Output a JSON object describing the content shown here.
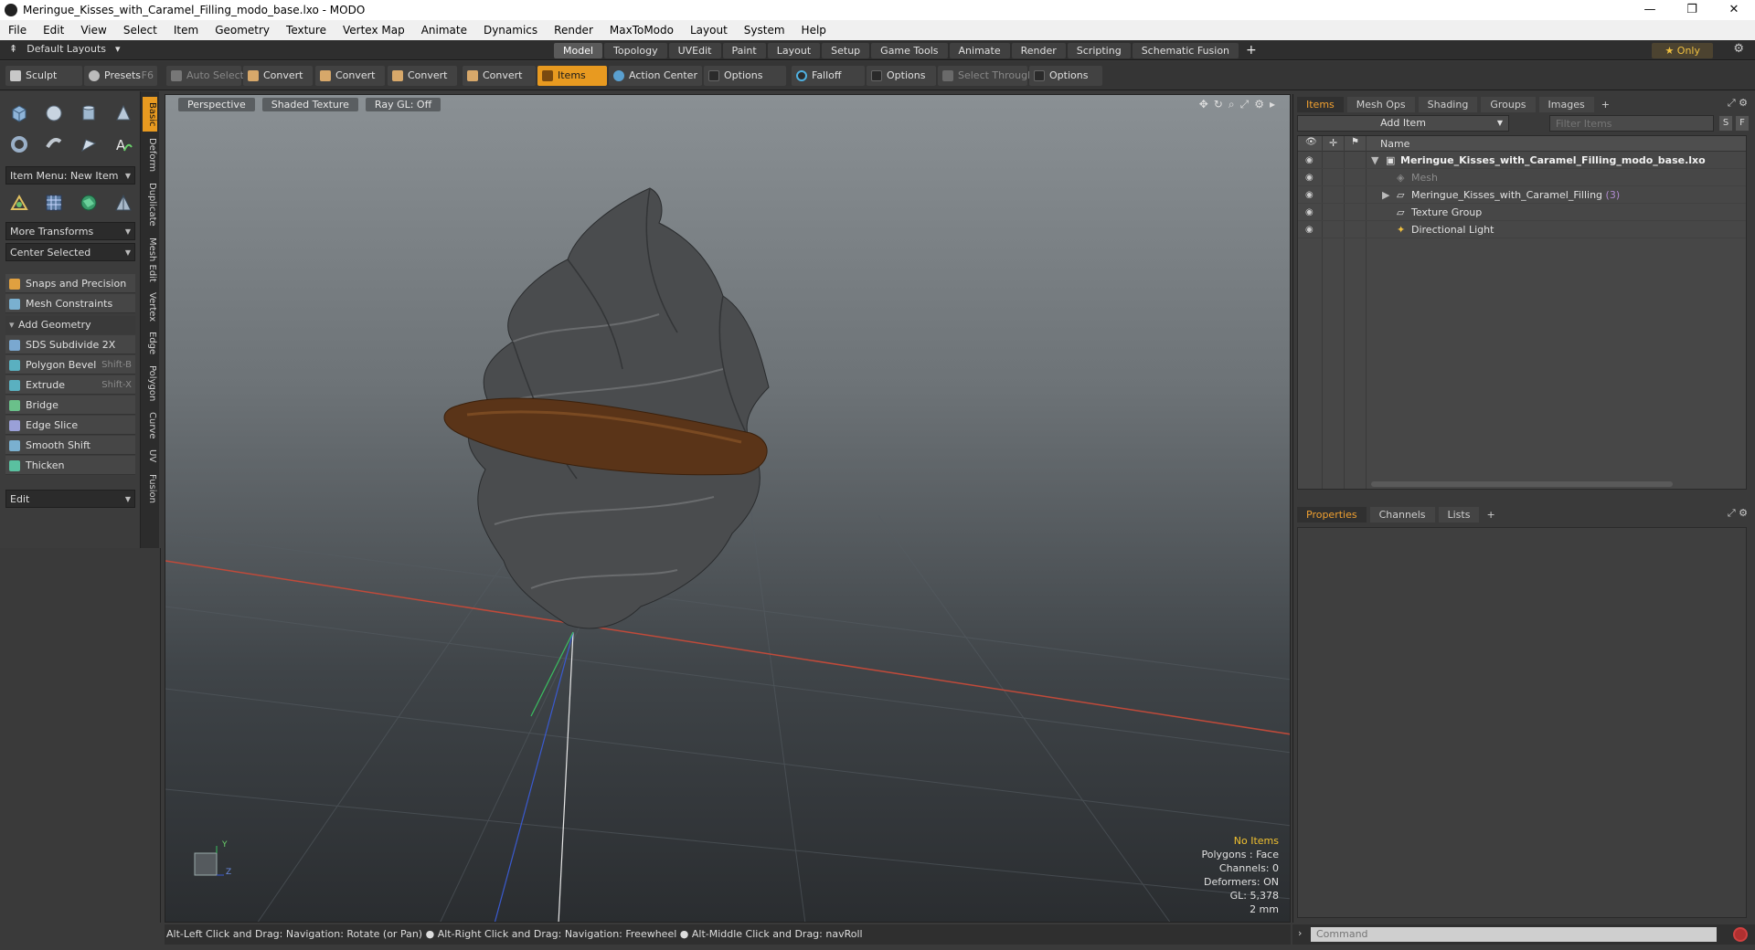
{
  "window": {
    "title": "Meringue_Kisses_with_Caramel_Filling_modo_base.lxo - MODO",
    "controls": [
      "—",
      "❐",
      "✕"
    ]
  },
  "menu": [
    "File",
    "Edit",
    "View",
    "Select",
    "Item",
    "Geometry",
    "Texture",
    "Vertex Map",
    "Animate",
    "Dynamics",
    "Render",
    "MaxToModo",
    "Layout",
    "System",
    "Help"
  ],
  "layoutbar": {
    "layouts_label": "Default Layouts",
    "tabs": [
      "Model",
      "Topology",
      "UVEdit",
      "Paint",
      "Layout",
      "Setup",
      "Game Tools",
      "Animate",
      "Render",
      "Scripting",
      "Schematic Fusion"
    ],
    "active_tab": "Model",
    "plus": "+",
    "only_label": "★  Only"
  },
  "toolbar": {
    "sculpt": "Sculpt",
    "presets": "Presets",
    "presets_key": "F6",
    "auto_select": "Auto Select",
    "convert1": "Convert",
    "convert2": "Convert",
    "convert3": "Convert",
    "convert4": "Convert",
    "items": "Items",
    "action_center": "Action Center",
    "options1": "Options",
    "falloff": "Falloff",
    "options2": "Options",
    "select_through": "Select Through",
    "options3": "Options"
  },
  "leftpanel": {
    "item_menu": "Item Menu: New Item",
    "more_transforms": "More Transforms",
    "center_selected": "Center Selected",
    "snaps": "Snaps and Precision",
    "mesh_constraints": "Mesh Constraints",
    "add_geometry": "Add Geometry",
    "tools": [
      {
        "label": "SDS Subdivide 2X",
        "shortcut": ""
      },
      {
        "label": "Polygon Bevel",
        "shortcut": "Shift-B"
      },
      {
        "label": "Extrude",
        "shortcut": "Shift-X"
      },
      {
        "label": "Bridge",
        "shortcut": ""
      },
      {
        "label": "Edge Slice",
        "shortcut": ""
      },
      {
        "label": "Smooth Shift",
        "shortcut": ""
      },
      {
        "label": "Thicken",
        "shortcut": ""
      }
    ],
    "edit_drop": "Edit",
    "vtabs": [
      "Basic",
      "Deform",
      "Duplicate",
      "Mesh Edit",
      "Vertex",
      "Edge",
      "Polygon",
      "Curve",
      "UV",
      "Fusion"
    ]
  },
  "viewport": {
    "view_mode": "Perspective",
    "shading": "Shaded Texture",
    "raygl": "Ray GL: Off",
    "stats": {
      "selection": "No Items",
      "polygons": "Polygons : Face",
      "channels": "Channels: 0",
      "deformers": "Deformers: ON",
      "gl": "GL: 5,378",
      "unit": "2 mm"
    },
    "axis_y": "Y",
    "axis_z": "Z"
  },
  "statusbar": {
    "hint": "Alt-Left Click and Drag: Navigation: Rotate (or Pan) ● Alt-Right Click and Drag: Navigation: Freewheel ● Alt-Middle Click and Drag: navRoll"
  },
  "items_panel": {
    "tabs": [
      "Items",
      "Mesh Ops",
      "Shading",
      "Groups",
      "Images"
    ],
    "plus": "+",
    "add_item": "Add Item",
    "filter_placeholder": "Filter Items",
    "btn_s": "S",
    "btn_f": "F",
    "col_name": "Name",
    "rows": [
      {
        "label": "Meringue_Kisses_with_Caramel_Filling_modo_base.lxo",
        "count": ""
      },
      {
        "label": "Mesh",
        "count": ""
      },
      {
        "label": "Meringue_Kisses_with_Caramel_Filling",
        "count": "(3)"
      },
      {
        "label": "Texture Group",
        "count": ""
      },
      {
        "label": "Directional Light",
        "count": ""
      }
    ]
  },
  "props_panel": {
    "tabs": [
      "Properties",
      "Channels",
      "Lists"
    ],
    "plus": "+"
  },
  "command": {
    "placeholder": "Command"
  }
}
